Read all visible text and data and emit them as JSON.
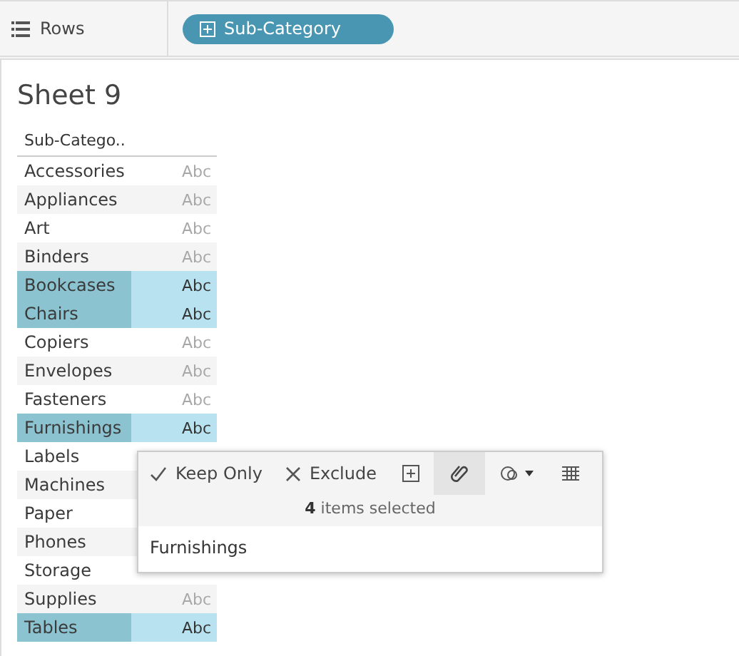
{
  "shelf": {
    "label": "Rows",
    "pill": "Sub-Category"
  },
  "sheet": {
    "title": "Sheet 9",
    "column": "Sub-Catego..",
    "rows": [
      {
        "name": "Accessories",
        "mark": "Abc",
        "selected": false
      },
      {
        "name": "Appliances",
        "mark": "Abc",
        "selected": false
      },
      {
        "name": "Art",
        "mark": "Abc",
        "selected": false
      },
      {
        "name": "Binders",
        "mark": "Abc",
        "selected": false
      },
      {
        "name": "Bookcases",
        "mark": "Abc",
        "selected": true
      },
      {
        "name": "Chairs",
        "mark": "Abc",
        "selected": true
      },
      {
        "name": "Copiers",
        "mark": "Abc",
        "selected": false
      },
      {
        "name": "Envelopes",
        "mark": "Abc",
        "selected": false
      },
      {
        "name": "Fasteners",
        "mark": "Abc",
        "selected": false
      },
      {
        "name": "Furnishings",
        "mark": "Abc",
        "selected": true
      },
      {
        "name": "Labels",
        "selected": false
      },
      {
        "name": "Machines",
        "selected": false
      },
      {
        "name": "Paper",
        "selected": false
      },
      {
        "name": "Phones",
        "selected": false
      },
      {
        "name": "Storage",
        "selected": false
      },
      {
        "name": "Supplies",
        "mark": "Abc",
        "selected": false
      },
      {
        "name": "Tables",
        "mark": "Abc",
        "selected": true
      }
    ]
  },
  "tooltip": {
    "keep": "Keep Only",
    "exclude": "Exclude",
    "summary": "**4** items selected",
    "value": "Furnishings"
  }
}
